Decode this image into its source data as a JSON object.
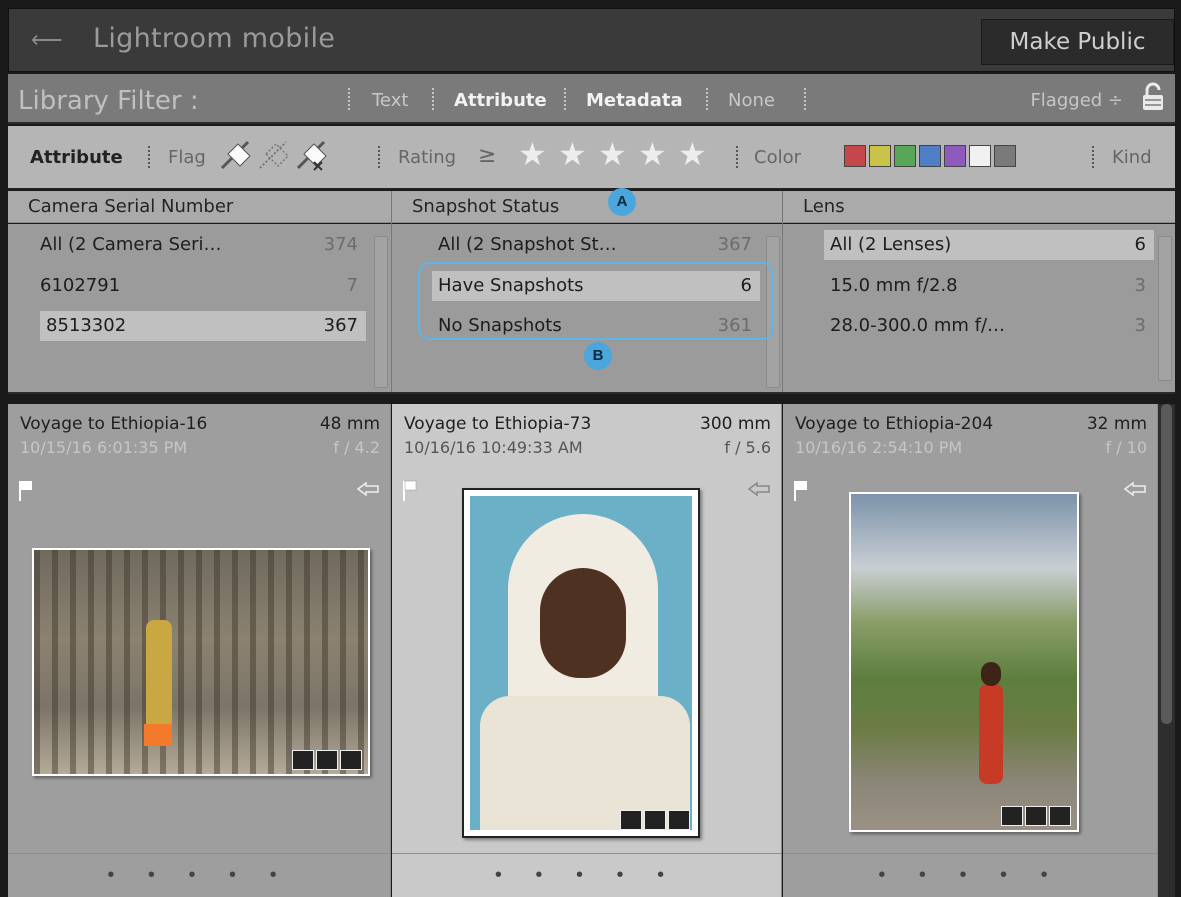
{
  "app": {
    "title": "Lightroom mobile",
    "make_public": "Make Public"
  },
  "library_filter": {
    "label": "Library Filter :",
    "tabs": [
      "Text",
      "Attribute",
      "Metadata",
      "None"
    ],
    "preset": "Flagged ÷"
  },
  "attribute_bar": {
    "label": "Attribute",
    "flag_label": "Flag",
    "rating_label": "Rating",
    "rating_op": "≥",
    "color_label": "Color",
    "kind_label": "Kind",
    "colors": [
      "#c6474b",
      "#c9c34a",
      "#57a65a",
      "#4f7ec7",
      "#8e5bbd",
      "#f1f1f1",
      "#7a7a7a"
    ]
  },
  "browser": {
    "columns": [
      {
        "header": "Camera Serial Number",
        "rows": [
          {
            "label": "All (2 Camera Seri…",
            "count": "374"
          },
          {
            "label": "6102791",
            "count": "7"
          },
          {
            "label": "8513302",
            "count": "367"
          }
        ]
      },
      {
        "header": "Snapshot Status",
        "rows": [
          {
            "label": "All (2 Snapshot St…",
            "count": "367"
          },
          {
            "label": "Have Snapshots",
            "count": "6"
          },
          {
            "label": "No Snapshots",
            "count": "361"
          }
        ]
      },
      {
        "header": "Lens",
        "rows": [
          {
            "label": "All (2 Lenses)",
            "count": "6"
          },
          {
            "label": "15.0 mm f/2.8",
            "count": "3"
          },
          {
            "label": "28.0-300.0 mm f/…",
            "count": "3"
          }
        ]
      }
    ],
    "callouts": [
      "A",
      "B"
    ]
  },
  "grid": [
    {
      "name": "Voyage to Ethiopia-16",
      "focal": "48 mm",
      "date": "10/15/16 6:01:35 PM",
      "aperture": "f / 4.2",
      "dots": "• • • • •"
    },
    {
      "name": "Voyage to Ethiopia-73",
      "focal": "300 mm",
      "date": "10/16/16 10:49:33 AM",
      "aperture": "f / 5.6",
      "dots": "• • • • •"
    },
    {
      "name": "Voyage to Ethiopia-204",
      "focal": "32 mm",
      "date": "10/16/16 2:54:10 PM",
      "aperture": "f / 10",
      "dots": "• • • • •"
    }
  ]
}
